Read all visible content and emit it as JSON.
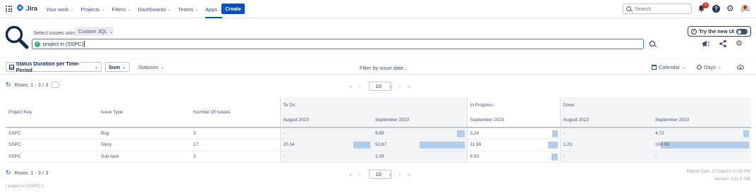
{
  "topnav": {
    "logo_text": "Jira",
    "items": [
      {
        "label": "Your work"
      },
      {
        "label": "Projects"
      },
      {
        "label": "Filters"
      },
      {
        "label": "Dashboards"
      },
      {
        "label": "Teams"
      },
      {
        "label": "Apps"
      }
    ],
    "active_item": "Apps",
    "create_label": "Create",
    "search_placeholder": "Search",
    "notification_count": "2",
    "help_label": "?"
  },
  "query": {
    "select_label": "Select issues using",
    "mode": "Custom JQL",
    "jql": "project in (SSPC)",
    "try_new_ui": "Try the new UI"
  },
  "toolbar": {
    "report_type": "Status Duration per Time-Period",
    "aggregation": "Sum",
    "statuses_label": "Statuses",
    "filter_date": "Filter by issue date...",
    "calendar_label": "Calendar",
    "unit_label": "Days"
  },
  "pagination": {
    "rows_text": "Rows: 1 - 3 / 3",
    "page_size": "10",
    "first": "«",
    "prev": "‹",
    "next": "›",
    "last": "»"
  },
  "table": {
    "col_headers": [
      "Project Key",
      "Issue Type",
      "Number Of Issues"
    ],
    "status_groups": [
      {
        "name": "To Do",
        "periods": [
          "August 2023",
          "September 2023"
        ]
      },
      {
        "name": "In Progress",
        "periods": [
          "September 2023"
        ]
      },
      {
        "name": "Done",
        "periods": [
          "August 2023",
          "September 2023"
        ]
      }
    ],
    "rows": [
      {
        "key": "SSPC",
        "type": "Bug",
        "count": "3",
        "values": [
          "-",
          "9.89",
          "3.24",
          "-",
          "4.72"
        ],
        "fractions": [
          0,
          0.09,
          0.03,
          0,
          0.045
        ]
      },
      {
        "key": "SSPC",
        "type": "Story",
        "count": "17",
        "values": [
          "20.14",
          "52.87",
          "11.90",
          "1.23",
          "104.09"
        ],
        "fractions": [
          0.19,
          0.51,
          0.11,
          0,
          1.0
        ]
      },
      {
        "key": "SSPC",
        "type": "Sub-task",
        "count": "3",
        "values": [
          "-",
          "1.03",
          "6.93",
          "-",
          "-"
        ],
        "fractions": [
          0,
          0,
          0.07,
          0,
          0
        ]
      }
    ]
  },
  "footer": {
    "report_date": "Report Date: 27/Sep/23 12:03 PM",
    "version": "Version: 3.11.0.745",
    "jql_echo": "[ project in (SSPC) ]"
  },
  "colors": {
    "accent": "#0052cc",
    "bar": "#b3cde8",
    "toggle_border": "#403294"
  }
}
